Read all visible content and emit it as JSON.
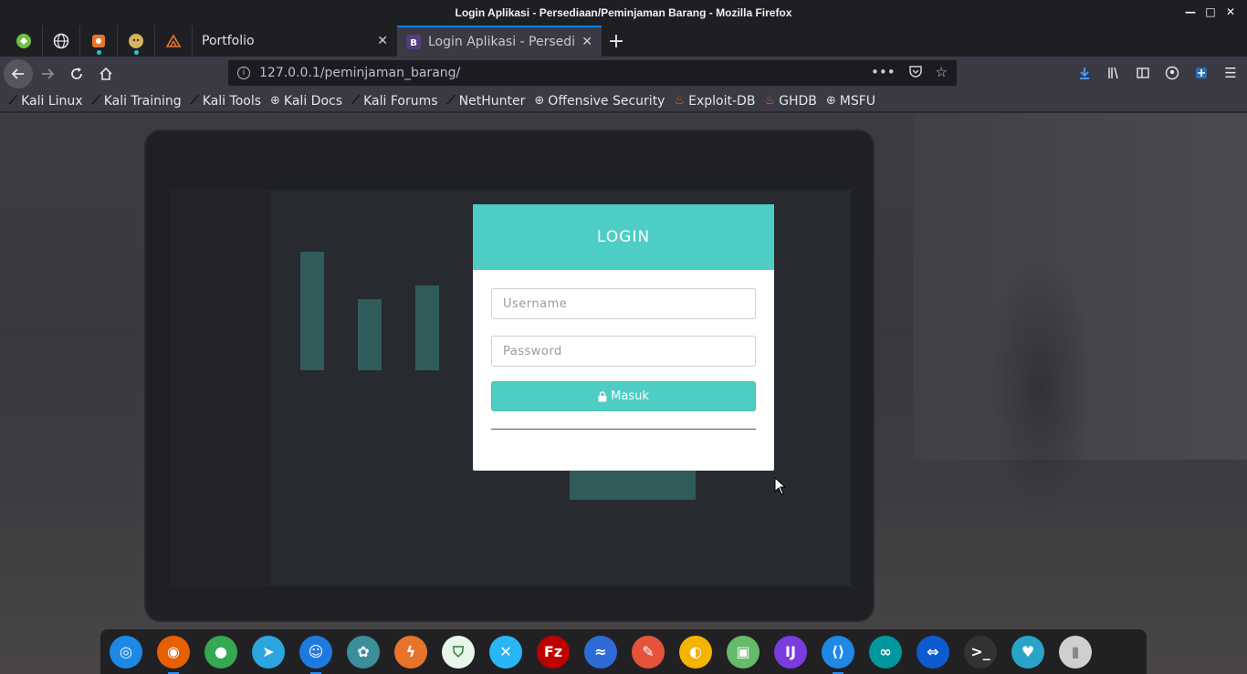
{
  "window": {
    "title": "Login Aplikasi - Persediaan/Peminjaman Barang - Mozilla Firefox",
    "controls": [
      "minimize",
      "maximize",
      "close"
    ]
  },
  "tabs": [
    {
      "label": "Portfolio",
      "active": false,
      "icon": ""
    },
    {
      "label": "Login Aplikasi - Persediaan",
      "active": true,
      "icon": "B"
    }
  ],
  "pinned_tabs": [
    "kali-pin-icon",
    "globe-pin-icon",
    "burp-pin-icon",
    "avatar-pin-icon",
    "dragon-pin-icon"
  ],
  "navbar": {
    "url": "127.0.0.1/peminjaman_barang/",
    "overflow": "•••"
  },
  "bookmarks": [
    {
      "label": "Kali Linux",
      "icon": "dragon-icon"
    },
    {
      "label": "Kali Training",
      "icon": "dragon-icon"
    },
    {
      "label": "Kali Tools",
      "icon": "dragon-icon"
    },
    {
      "label": "Kali Docs",
      "icon": "globe-icon"
    },
    {
      "label": "Kali Forums",
      "icon": "dragon-icon"
    },
    {
      "label": "NetHunter",
      "icon": "dragon-icon"
    },
    {
      "label": "Offensive Security",
      "icon": "globe-icon"
    },
    {
      "label": "Exploit-DB",
      "icon": "flame-icon"
    },
    {
      "label": "GHDB",
      "icon": "flame-icon"
    },
    {
      "label": "MSFU",
      "icon": "globe-icon"
    }
  ],
  "login": {
    "heading": "LOGIN",
    "username_placeholder": "Username",
    "password_placeholder": "Password",
    "submit_label": "Masuk",
    "accent": "#4ecdc4"
  },
  "dock": [
    {
      "name": "safari-icon",
      "color": "#1e88e5",
      "glyph": "◎"
    },
    {
      "name": "firefox-icon",
      "color": "#e66000",
      "glyph": "◉"
    },
    {
      "name": "chrome-icon",
      "color": "#34a853",
      "glyph": "●"
    },
    {
      "name": "telegram-icon",
      "color": "#2ca5e0",
      "glyph": "➤"
    },
    {
      "name": "finder-icon",
      "color": "#1f7ae0",
      "glyph": "☺"
    },
    {
      "name": "anime-icon",
      "color": "#3b8e9a",
      "glyph": "✿"
    },
    {
      "name": "burp-icon",
      "color": "#e8742b",
      "glyph": "ϟ"
    },
    {
      "name": "shield-icon",
      "color": "#e8f5e9",
      "glyph": "⛉"
    },
    {
      "name": "remote-icon",
      "color": "#29b6f6",
      "glyph": "✕"
    },
    {
      "name": "filezilla-icon",
      "color": "#bf0000",
      "glyph": "Fz"
    },
    {
      "name": "kali-icon",
      "color": "#2f6bd7",
      "glyph": "≈"
    },
    {
      "name": "pencil-icon",
      "color": "#e5533a",
      "glyph": "✎"
    },
    {
      "name": "colorwheel-icon",
      "color": "#f4b400",
      "glyph": "◐"
    },
    {
      "name": "box-icon",
      "color": "#66bb6a",
      "glyph": "▣"
    },
    {
      "name": "intellij-icon",
      "color": "#7a3cde",
      "glyph": "IJ"
    },
    {
      "name": "vscode-icon",
      "color": "#1e88e5",
      "glyph": "⟨⟩"
    },
    {
      "name": "arduino-icon",
      "color": "#00979d",
      "glyph": "∞"
    },
    {
      "name": "teamviewer-icon",
      "color": "#0e5bcf",
      "glyph": "⇔"
    },
    {
      "name": "terminal-icon",
      "color": "#333333",
      "glyph": ">_"
    },
    {
      "name": "monitor-icon",
      "color": "#2aa3c8",
      "glyph": "♥"
    },
    {
      "name": "trash-icon",
      "color": "#cfcfcf",
      "glyph": "▮"
    }
  ]
}
